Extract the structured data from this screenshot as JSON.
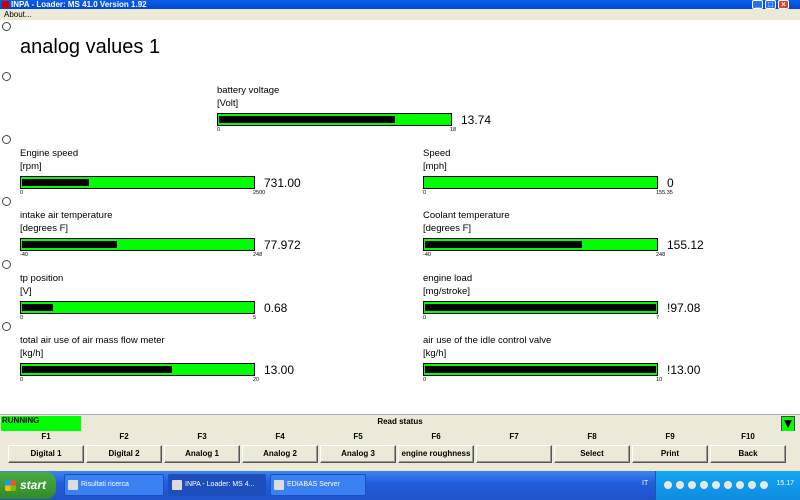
{
  "window": {
    "title": "INPA - Loader:  MS 41.0 Version 1.92"
  },
  "menu": {
    "about": "About..."
  },
  "page": {
    "title": "analog values 1"
  },
  "gauges": {
    "battery": {
      "label": "battery voltage",
      "unit": "[Volt]",
      "value": "13.74",
      "min": "0",
      "max": "18",
      "fraction": 0.76
    },
    "engine": {
      "label": "Engine speed",
      "unit": "[rpm]",
      "value": "731.00",
      "min": "0",
      "max": "2500",
      "fraction": 0.29
    },
    "speed": {
      "label": "Speed",
      "unit": "[mph]",
      "value": "0",
      "min": "0",
      "max": "155.35",
      "fraction": 0.0
    },
    "intake": {
      "label": "intake air temperature",
      "unit": "[degrees F]",
      "value": "77.972",
      "min": "-40",
      "max": "248",
      "fraction": 0.41
    },
    "coolant": {
      "label": "Coolant temperature",
      "unit": "[degrees F]",
      "value": "155.12",
      "min": "-40",
      "max": "248",
      "fraction": 0.68
    },
    "tp": {
      "label": "tp position",
      "unit": "[V]",
      "value": "0.68",
      "min": "0",
      "max": "5",
      "fraction": 0.136
    },
    "load": {
      "label": "engine load",
      "unit": "[mg/stroke]",
      "value": "!97.08",
      "min": "0",
      "max": "7",
      "fraction": 1.0
    },
    "maf": {
      "label": "total air use of air mass flow meter",
      "unit": "[kg/h]",
      "value": "13.00",
      "min": "0",
      "max": "20",
      "fraction": 0.65
    },
    "idle": {
      "label": "air use of the idle control valve",
      "unit": "[kg/h]",
      "value": "!13.00",
      "min": "0",
      "max": "10",
      "fraction": 1.0
    }
  },
  "status": {
    "running": "RUNNING",
    "text": "Read status"
  },
  "fkeys": [
    {
      "key": "F1",
      "label": "Digital 1"
    },
    {
      "key": "F2",
      "label": "Digital 2"
    },
    {
      "key": "F3",
      "label": "Analog 1"
    },
    {
      "key": "F4",
      "label": "Analog 2"
    },
    {
      "key": "F5",
      "label": "Analog 3"
    },
    {
      "key": "F6",
      "label": "engine roughness"
    },
    {
      "key": "F7",
      "label": ""
    },
    {
      "key": "F8",
      "label": "Select"
    },
    {
      "key": "F9",
      "label": "Print"
    },
    {
      "key": "F10",
      "label": "Back"
    }
  ],
  "taskbar": {
    "start": "start",
    "tasks": [
      {
        "label": "Risultati ricerca"
      },
      {
        "label": "INPA - Loader:  MS 4..."
      },
      {
        "label": "EDIABAS Server"
      }
    ],
    "lang": "IT",
    "clock": "15.17"
  },
  "colors": {
    "bar": "#00ff00",
    "fill": "#000000",
    "titlebar": "#0054e3"
  }
}
